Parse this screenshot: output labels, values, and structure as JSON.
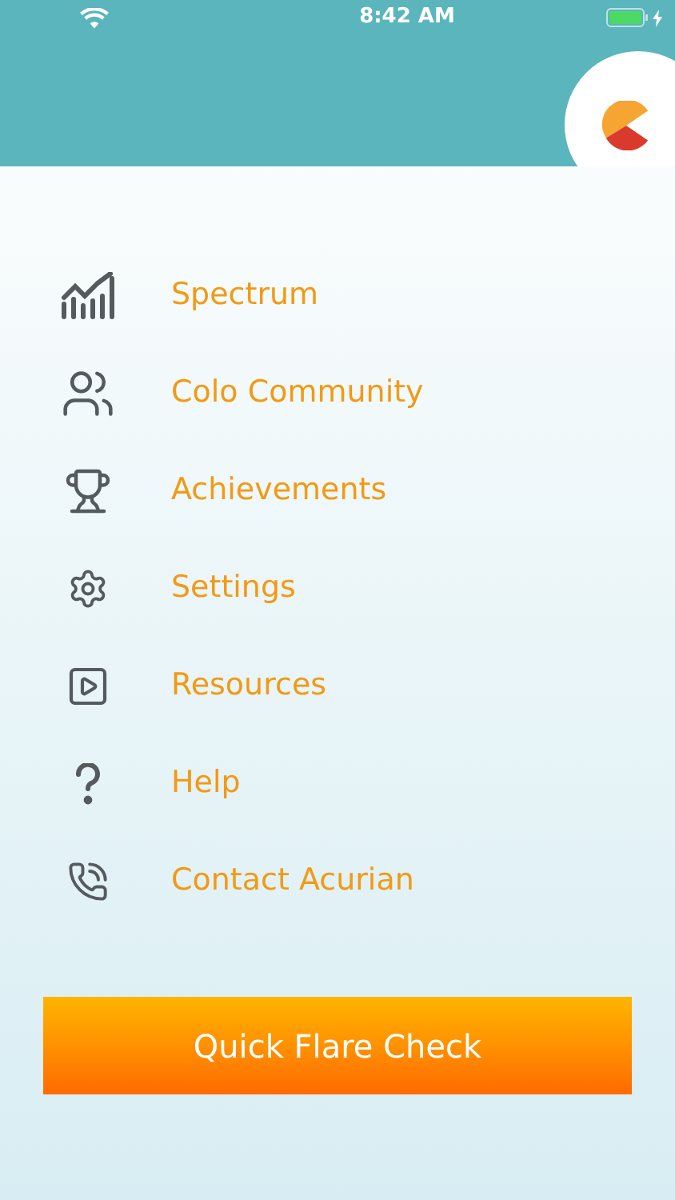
{
  "status_bar": {
    "time": "8:42 AM",
    "battery_charging": true
  },
  "menu": [
    {
      "kind": "chart",
      "label": "Spectrum"
    },
    {
      "kind": "community",
      "label": "Colo Community"
    },
    {
      "kind": "trophy",
      "label": "Achievements"
    },
    {
      "kind": "settings",
      "label": "Settings"
    },
    {
      "kind": "video",
      "label": "Resources"
    },
    {
      "kind": "help",
      "label": "Help"
    },
    {
      "kind": "phone",
      "label": "Contact Acurian"
    }
  ],
  "action_button": {
    "label": "Quick Flare Check"
  }
}
